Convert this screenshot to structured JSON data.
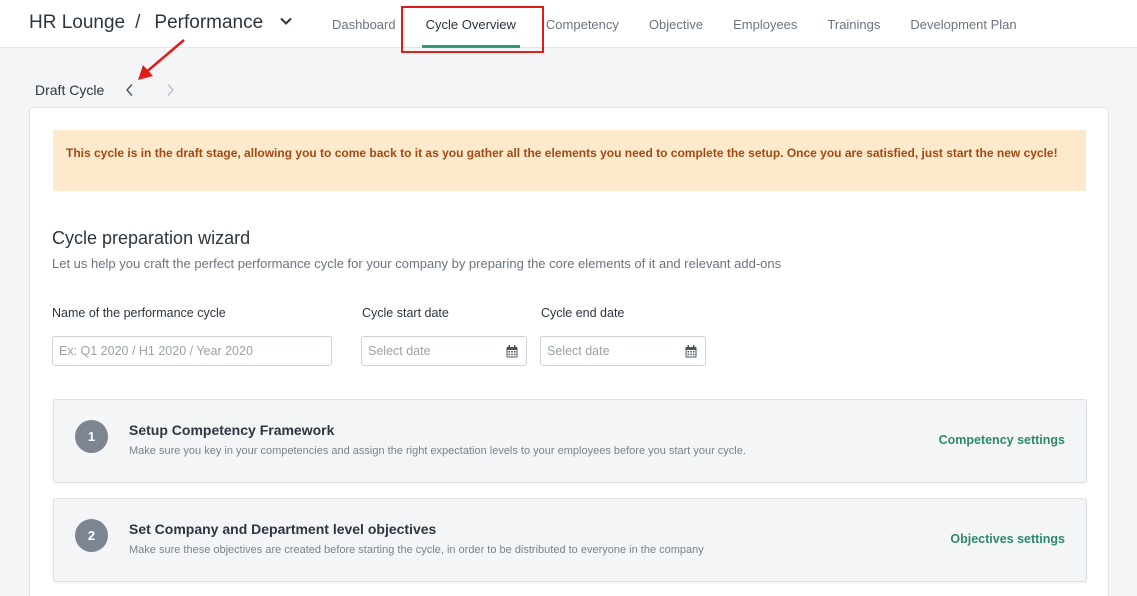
{
  "header": {
    "brand": "HR Lounge",
    "separator": "/",
    "module": "Performance",
    "tabs": [
      {
        "label": "Dashboard"
      },
      {
        "label": "Cycle Overview"
      },
      {
        "label": "Competency"
      },
      {
        "label": "Objective"
      },
      {
        "label": "Employees"
      },
      {
        "label": "Trainings"
      },
      {
        "label": "Development Plan"
      }
    ],
    "active_tab": "Cycle Overview"
  },
  "cycle": {
    "title": "Draft Cycle"
  },
  "banner": {
    "text": "This cycle is in the draft stage, allowing you to come back to it as you gather all the elements you need to complete the setup. Once you are satisfied, just start the new cycle!"
  },
  "wizard": {
    "title": "Cycle preparation wizard",
    "subtitle": "Let us help you craft the perfect performance cycle for your company by preparing the core elements of it and relevant add-ons",
    "fields": {
      "name_label": "Name of the performance cycle",
      "name_placeholder": "Ex: Q1 2020 / H1 2020 / Year 2020",
      "start_label": "Cycle start date",
      "start_placeholder": "Select date",
      "end_label": "Cycle end date",
      "end_placeholder": "Select date"
    },
    "steps": [
      {
        "number": "1",
        "title": "Setup Competency Framework",
        "description": "Make sure you key in your competencies and assign the right expectation levels to your employees before you start your cycle.",
        "link": "Competency settings"
      },
      {
        "number": "2",
        "title": "Set Company and Department level objectives",
        "description": "Make sure these objectives are created before starting the cycle, in order to be distributed to everyone in the company",
        "link": "Objectives settings"
      }
    ]
  },
  "colors": {
    "accent": "#2e9a76",
    "banner_bg": "#fde9cc",
    "banner_text": "#a14a12",
    "annotation": "#e21b1b"
  }
}
